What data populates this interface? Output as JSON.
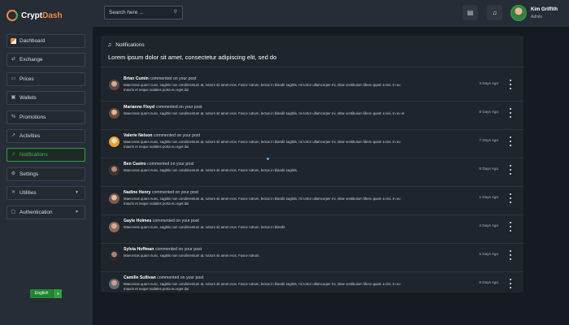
{
  "brand": {
    "prefix": "Crypt",
    "suffix": "Dash"
  },
  "search": {
    "placeholder": "Search here ..."
  },
  "user": {
    "name": "Kim Griffith",
    "role": "Admin"
  },
  "nav": [
    {
      "label": "Dashboard",
      "icon": "dashboard-icon"
    },
    {
      "label": "Exchange",
      "icon": "exchange-icon"
    },
    {
      "label": "Prices",
      "icon": "prices-icon"
    },
    {
      "label": "Wallets",
      "icon": "wallet-icon"
    },
    {
      "label": "Promotions",
      "icon": "percent-icon"
    },
    {
      "label": "Activities",
      "icon": "activity-icon"
    },
    {
      "label": "Notifications",
      "icon": "bell-icon",
      "active": true
    },
    {
      "label": "Settings",
      "icon": "gear-icon"
    },
    {
      "label": "Utilities",
      "icon": "tools-icon"
    },
    {
      "label": "Authentication",
      "icon": "lock-icon"
    }
  ],
  "language": {
    "selected": "English"
  },
  "panel": {
    "title": "Notifications",
    "subtitle": "Lorem ipsum dolor sit amet, consectetur adipiscing elit, sed do"
  },
  "notifications": [
    {
      "name": "Brian Cumin",
      "action": "commented on your post",
      "body": "Maecenas quam nunc, sagittis non condimentum at, rutrum sit amet eros. Fusce rutrum, lectus in blandit sagittis, mi tortor ullamcorper mi, vitae vestibulum libero quam a nisi. In eu mauris et neque sodales porta eu eget dui",
      "time": "3 Days Ago"
    },
    {
      "name": "Marianne Floyd",
      "action": "commented on your post",
      "body": "Maecenas quam nunc, sagittis non condimentum at, rutrum sit amet eros. Fusce rutrum, lectus in blandit sagittis, mi tortor ullamcorper mi, vitae vestibulum libero quam a nisi. In eu et",
      "time": "8 Days Ago"
    },
    {
      "name": "Valerie Nelson",
      "action": "commented on your post",
      "body": "Maecenas quam nunc, sagittis non condimentum at, rutrum sit amet eros. Fusce rutrum, lectus in blandit sagittis, mi tortor ullamcorper mi, vitae vestibulum libero quam a nisi. In eu mauris et neque sodales porta eu eget dui",
      "time": "7 Days Ago"
    },
    {
      "name": "Ben Castro",
      "action": "commented on your post",
      "body": "Maecenas quam nunc, sagittis non condimentum at, rutrum sit amet eros. Fusce rutrum, lectus in blandit sagittis,",
      "time": "8 Days Ago"
    },
    {
      "name": "Nadine Henry",
      "action": "commented on your post",
      "body": "Maecenas quam nunc, sagittis non condimentum at, rutrum sit amet eros. Fusce rutrum, lectus in blandit sagittis, mi tortor ullamcorper mi, vitae vestibulum libero quam a nisi. In eu mauris et neque sodales porta eu eget dui",
      "time": "1 Days Ago"
    },
    {
      "name": "Gayle Holmes",
      "action": "commented on your post",
      "body": "Maecenas quam nunc, sagittis non condimentum at, rutrum sit amet eros. Fusce rutrum, lectus in blandit",
      "time": "2 Days Ago"
    },
    {
      "name": "Sylvia Hoffman",
      "action": "commented on your post",
      "body": "Maecenas quam nunc, sagittis non condimentum at, rutrum sit amet eros. Fusce rutrum,",
      "time": "5 Days Ago"
    },
    {
      "name": "Camille Sullivan",
      "action": "commented on your post",
      "body": "Maecenas quam nunc, sagittis non condimentum at, rutrum sit amet eros. Fusce rutrum, lectus in blandit sagittis, mi tortor ullamcorper mi, vitae vestibulum libero quam a nisi. In eu mauris et neque sodales porta eu eget dui",
      "time": "6 Days Ago"
    }
  ],
  "colors": {
    "accent": "#3fb950",
    "brand": "#f0883e",
    "link": "#58a6ff"
  }
}
